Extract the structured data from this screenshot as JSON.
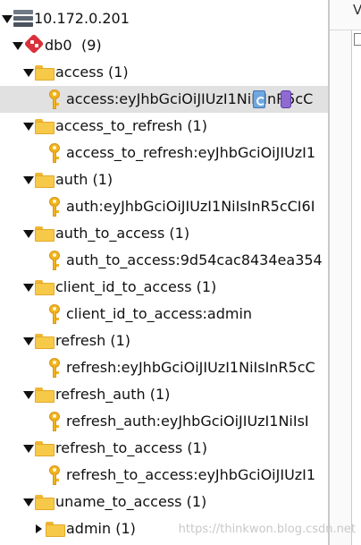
{
  "server": {
    "label": "10.172.0.201",
    "icon": "server-icon"
  },
  "db": {
    "label": "db0",
    "count": "(9)",
    "icon": "redis-db-icon"
  },
  "folders": [
    {
      "label": "access (1)",
      "key": "access:eyJhbGciOiJIUzI1NiIsInR5cC",
      "selected": true
    },
    {
      "label": "access_to_refresh (1)",
      "key": "access_to_refresh:eyJhbGciOiJIUzI1"
    },
    {
      "label": "auth (1)",
      "key": "auth:eyJhbGciOiJIUzI1NiIsInR5cCI6I"
    },
    {
      "label": "auth_to_access (1)",
      "key": "auth_to_access:9d54cac8434ea354"
    },
    {
      "label": "client_id_to_access (1)",
      "key": "client_id_to_access:admin"
    },
    {
      "label": "refresh (1)",
      "key": "refresh:eyJhbGciOiJIUzI1NiIsInR5cC"
    },
    {
      "label": "refresh_auth (1)",
      "key": "refresh_auth:eyJhbGciOiJIUzI1NiIsI"
    },
    {
      "label": "refresh_to_access (1)",
      "key": "refresh_to_access:eyJhbGciOiJIUzI1"
    },
    {
      "label": "uname_to_access (1)"
    }
  ],
  "subfolder": {
    "label": "admin (1)"
  },
  "right_pane": {
    "header_char": "V"
  },
  "watermark": "https://thinkwon.blog.csdn.net"
}
